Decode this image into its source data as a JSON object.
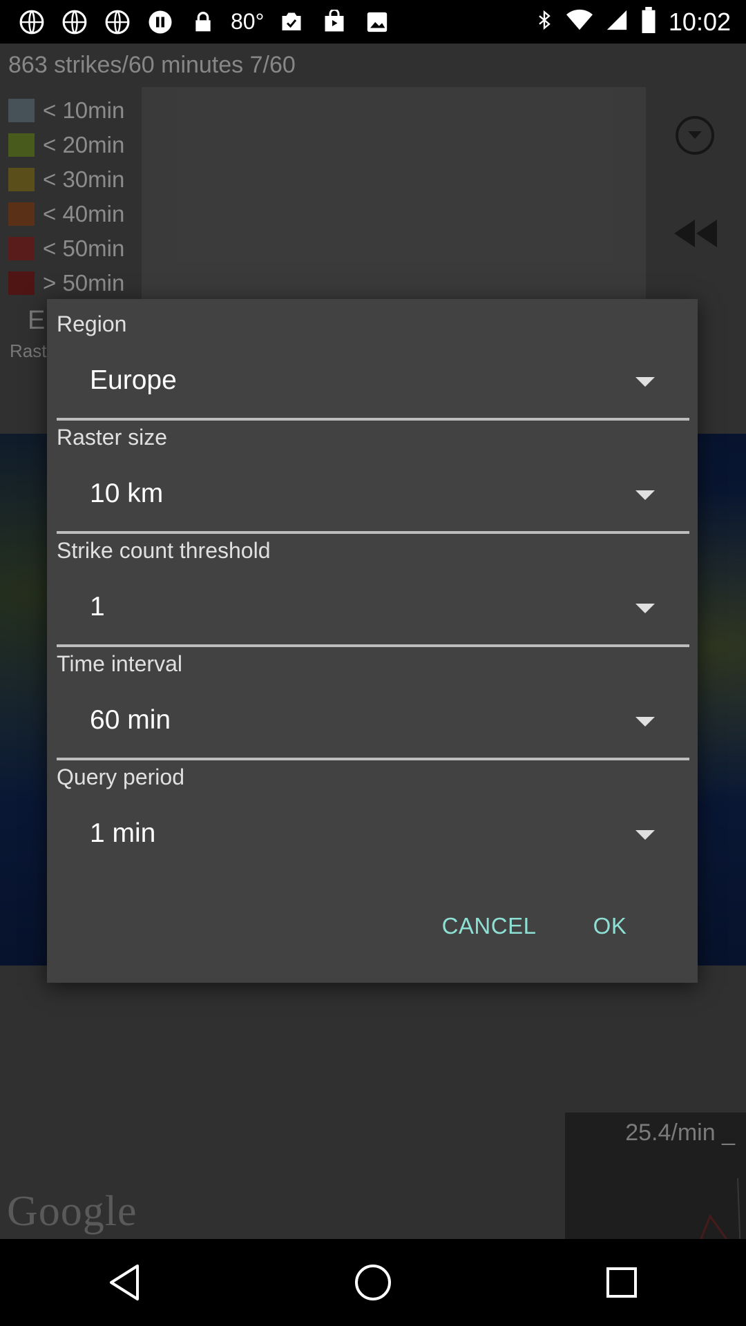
{
  "status_bar": {
    "temperature": "80°",
    "time": "10:02",
    "icons": [
      "globe-icon",
      "globe-icon",
      "globe-icon",
      "pause-icon",
      "lock-icon",
      "thermometer-icon",
      "image-check-icon",
      "play-store-icon",
      "photo-icon",
      "bluetooth-icon",
      "wifi-icon",
      "signal-icon",
      "battery-icon"
    ]
  },
  "app": {
    "strike_summary": "863 strikes/60 minutes 7/60",
    "legend": [
      {
        "label": "< 10min",
        "color": "#6c7f88"
      },
      {
        "label": "< 20min",
        "color": "#6f8a2b"
      },
      {
        "label": "< 30min",
        "color": "#8b7a2a"
      },
      {
        "label": "< 40min",
        "color": "#8a4a23"
      },
      {
        "label": "< 50min",
        "color": "#8a2a2a"
      },
      {
        "label": "> 50min",
        "color": "#7a2020"
      }
    ],
    "left_fragment_1": "E",
    "left_fragment_2": "Rast",
    "map_attribution": "Google",
    "rate_label": "25.4/min _"
  },
  "dialog": {
    "fields": [
      {
        "label": "Region",
        "value": "Europe"
      },
      {
        "label": "Raster size",
        "value": "10 km"
      },
      {
        "label": "Strike count threshold",
        "value": "1"
      },
      {
        "label": "Time interval",
        "value": "60 min"
      },
      {
        "label": "Query period",
        "value": "1 min"
      }
    ],
    "cancel_label": "CANCEL",
    "ok_label": "OK"
  },
  "colors": {
    "dialog_bg": "#424242",
    "accent": "#8fe0d4"
  }
}
